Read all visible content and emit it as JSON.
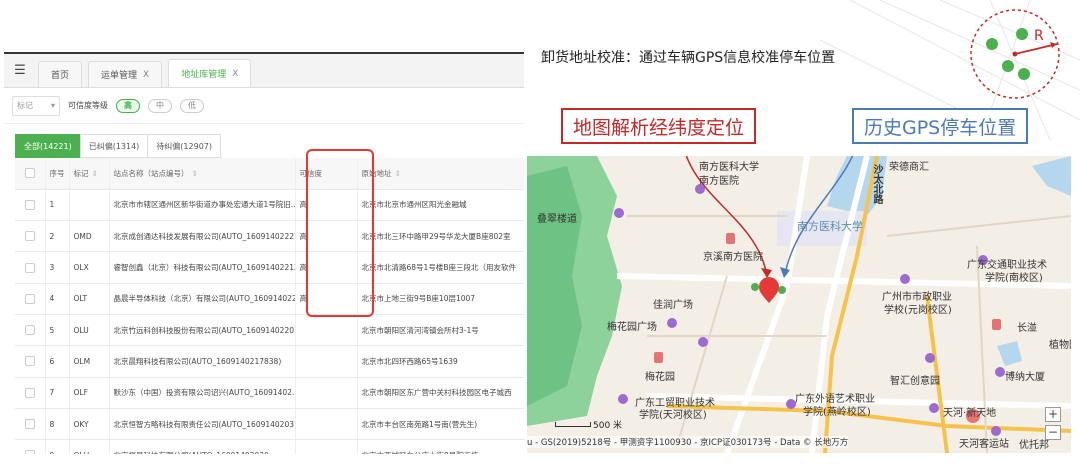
{
  "app": {
    "tabs": [
      {
        "label": "首页",
        "closable": false
      },
      {
        "label": "运单管理",
        "closable": true
      },
      {
        "label": "地址库管理",
        "closable": true,
        "active": true
      }
    ],
    "close_glyph": "X",
    "filter": {
      "tag_placeholder": "标记",
      "credibility_label": "可信度等级",
      "levels": [
        "高",
        "中",
        "低"
      ],
      "selected_level": "高"
    },
    "subtabs": [
      {
        "label": "全部(14221)",
        "active": true
      },
      {
        "label": "已纠偏(1314)"
      },
      {
        "label": "待纠偏(12907)"
      }
    ],
    "table": {
      "headers": [
        "序号",
        "标记",
        "站点名称（站点编号）",
        "可信度",
        "原始地址"
      ],
      "rows": [
        {
          "no": "1",
          "tag": "",
          "name": "北京市市辖区通州区新华街道办事处宏通大道1号院旧...",
          "cred": "高",
          "addr": "北京市北京市通州区阳光金融城"
        },
        {
          "no": "2",
          "tag": "OMD",
          "name": "北京成创通达科技发展有限公司(AUTO_16091402227...",
          "cred": "高",
          "addr": "北京市北三环中路甲29号华龙大厦B座802室"
        },
        {
          "no": "3",
          "tag": "OLX",
          "name": "睿智创鑫（北京）科技有限公司(AUTO_16091402212...",
          "cred": "高",
          "addr": "北京市北清路68号1号楼B座三段北（用友软件"
        },
        {
          "no": "4",
          "tag": "OLT",
          "name": "晶晨半导体科技（北京）有限公司(AUTO_160914022...",
          "cred": "高",
          "addr": "北京市上地三街9号B座10层1007"
        },
        {
          "no": "5",
          "tag": "OLU",
          "name": "北京竹远科创科技股份有限公司(AUTO_16091402201...",
          "cred": "",
          "addr": "北京市朝阳区清河湾镇会所村3-1号"
        },
        {
          "no": "6",
          "tag": "OLM",
          "name": "北京晨翔科技有限公司(AUTO_1609140217838)",
          "cred": "",
          "addr": "北京市北四环西路65号1639"
        },
        {
          "no": "7",
          "tag": "OLF",
          "name": "默沙东（中国）投资有限公司诏兴(AUTO_16091402...",
          "cred": "",
          "addr": "北京市朝阳区东广营中关村科技园区电子城西"
        },
        {
          "no": "8",
          "tag": "OKY",
          "name": "北京恒智方略科技有限责任公司(AUTO_16091402031...",
          "cred": "",
          "addr": "北京市丰台区南苑路1号南(营先生)"
        },
        {
          "no": "9",
          "tag": "OLH",
          "name": "北京恒星科技有限公司(AUTO_16091402030...",
          "cred": "",
          "addr": "北京市西城区车公庄大街9号院五栋"
        }
      ]
    }
  },
  "annotation": {
    "title": "卸货地址校准：通过车辆GPS信息校准停车位置",
    "map_label": "地图解析经纬度定位",
    "gps_label": "历史GPS停车位置",
    "radius_letter": "R",
    "colors": {
      "red": "#c62828",
      "blue": "#4a7ab8",
      "green": "#4caf50"
    }
  },
  "map": {
    "labels": [
      {
        "text": "南方医科大学",
        "kind": "poi"
      },
      {
        "text": "南方医院",
        "kind": "poi"
      },
      {
        "text": "南方医科大学",
        "kind": "campus"
      },
      {
        "text": "京溪南方医院",
        "kind": "poi"
      },
      {
        "text": "佳润广场",
        "kind": "poi"
      },
      {
        "text": "梅花园广场",
        "kind": "poi"
      },
      {
        "text": "梅花园",
        "kind": "poi"
      },
      {
        "text": "广东工贸职业技术",
        "kind": "poi"
      },
      {
        "text": "学院(天河校区)",
        "kind": "poi"
      },
      {
        "text": "广东外语艺术职业",
        "kind": "poi"
      },
      {
        "text": "学院(燕岭校区)",
        "kind": "poi"
      },
      {
        "text": "广州市市政职业",
        "kind": "poi"
      },
      {
        "text": "学校(元岗校区)",
        "kind": "poi"
      },
      {
        "text": "广东交通职业技术",
        "kind": "poi"
      },
      {
        "text": "学院(南校区)",
        "kind": "poi"
      },
      {
        "text": "智汇创意园",
        "kind": "poi"
      },
      {
        "text": "博纳大厦",
        "kind": "poi"
      },
      {
        "text": "天河·新天地",
        "kind": "poi"
      },
      {
        "text": "天河客运站",
        "kind": "poi"
      },
      {
        "text": "优托邦",
        "kind": "poi"
      },
      {
        "text": "荣德商汇",
        "kind": "poi"
      },
      {
        "text": "长湴",
        "kind": "poi"
      },
      {
        "text": "植物园",
        "kind": "poi"
      },
      {
        "text": "叠翠楼道",
        "kind": "poi"
      },
      {
        "text": "沙太北路",
        "kind": "road"
      }
    ],
    "scale_label": "500 米",
    "copyright": "u - GS(2019)5218号 - 甲测资字1100930 - 京ICP证030173号 - Data © 长地万方",
    "zoom_in": "+",
    "zoom_out": "−"
  }
}
